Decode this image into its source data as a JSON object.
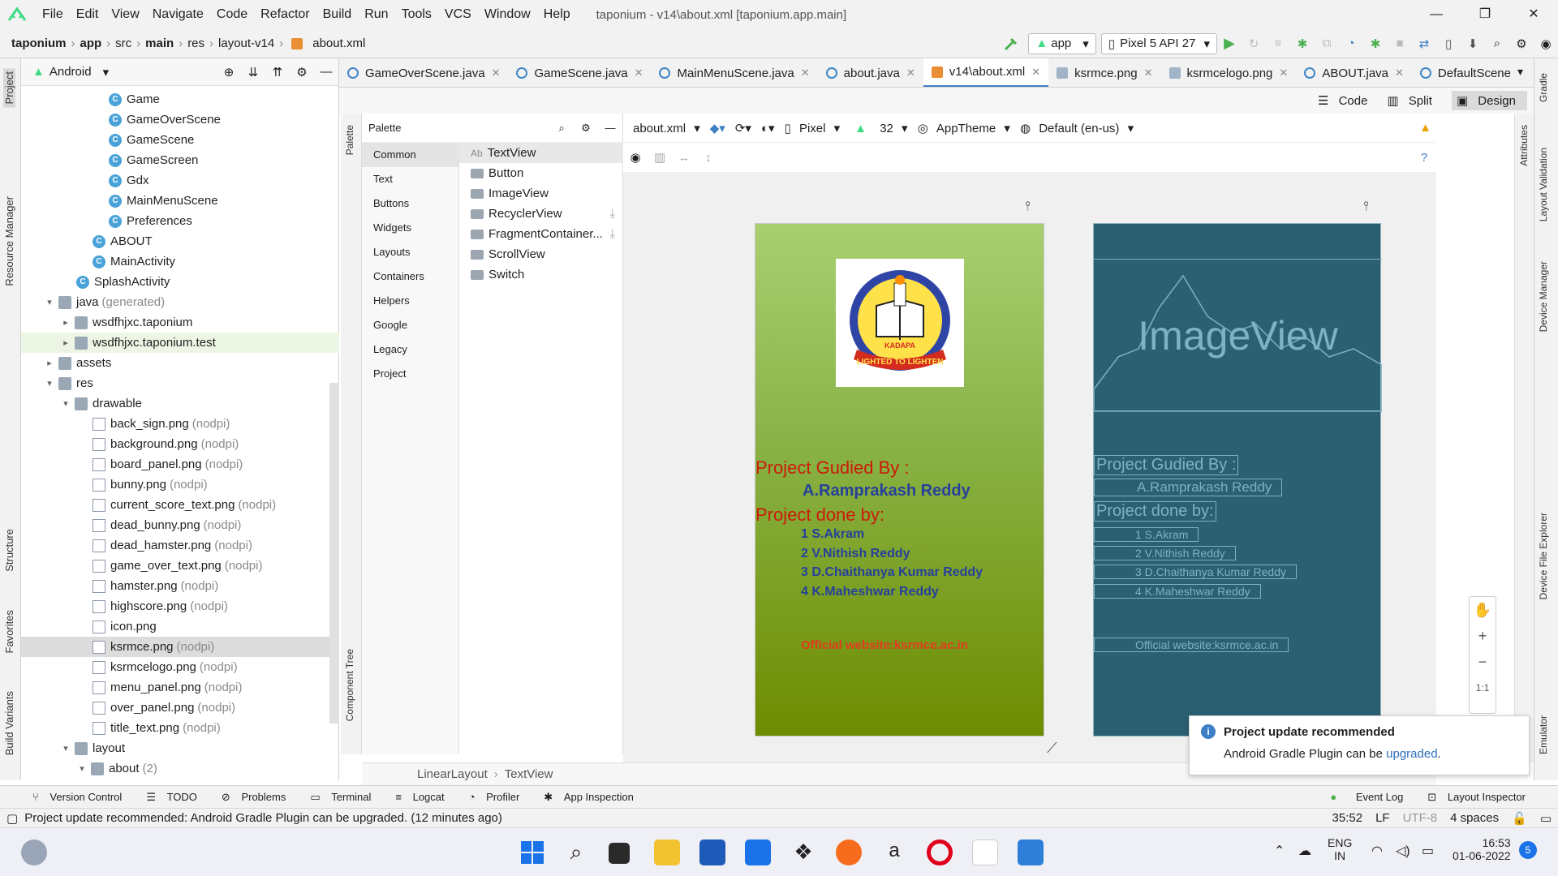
{
  "menubar": {
    "items": [
      "File",
      "Edit",
      "View",
      "Navigate",
      "Code",
      "Refactor",
      "Build",
      "Run",
      "Tools",
      "VCS",
      "Window",
      "Help"
    ],
    "title": "taponium - v14\\about.xml [taponium.app.main]"
  },
  "navbar": {
    "crumbs": [
      "taponium",
      "app",
      "src",
      "main",
      "res",
      "layout-v14",
      "about.xml"
    ],
    "run_config": "app",
    "device": "Pixel 5 API 27"
  },
  "project": {
    "view": "Android",
    "tree": [
      {
        "label": "Game",
        "type": "class",
        "indent": 5,
        "y": 0
      },
      {
        "label": "GameOverScene",
        "type": "class",
        "indent": 5,
        "y": 1
      },
      {
        "label": "GameScene",
        "type": "class",
        "indent": 5,
        "y": 2
      },
      {
        "label": "GameScreen",
        "type": "class",
        "indent": 5,
        "y": 3
      },
      {
        "label": "Gdx",
        "type": "class",
        "indent": 5,
        "y": 4
      },
      {
        "label": "MainMenuScene",
        "type": "class",
        "indent": 5,
        "y": 5
      },
      {
        "label": "Preferences",
        "type": "class",
        "indent": 5,
        "y": 6
      },
      {
        "label": "ABOUT",
        "type": "class",
        "indent": 4,
        "y": 7
      },
      {
        "label": "MainActivity",
        "type": "class",
        "indent": 4,
        "y": 8
      },
      {
        "label": "SplashActivity",
        "type": "class",
        "indent": 3,
        "y": 9
      },
      {
        "label": "java",
        "muted": "(generated)",
        "type": "folder",
        "indent": 1,
        "arrow": "▾",
        "y": 10
      },
      {
        "label": "wsdfhjxc.taponium",
        "type": "folder",
        "indent": 2,
        "arrow": "▸",
        "y": 11
      },
      {
        "label": "wsdfhjxc.taponium.test",
        "type": "folder",
        "indent": 2,
        "arrow": "▸",
        "y": 12,
        "hl": true
      },
      {
        "label": "assets",
        "type": "folder",
        "indent": 1,
        "arrow": "▸",
        "y": 13
      },
      {
        "label": "res",
        "type": "folder",
        "indent": 1,
        "arrow": "▾",
        "y": 14
      },
      {
        "label": "drawable",
        "type": "folder",
        "indent": 2,
        "arrow": "▾",
        "y": 15
      },
      {
        "label": "back_sign.png",
        "muted": "(nodpi)",
        "type": "file",
        "indent": 4,
        "y": 16
      },
      {
        "label": "background.png",
        "muted": "(nodpi)",
        "type": "file",
        "indent": 4,
        "y": 17
      },
      {
        "label": "board_panel.png",
        "muted": "(nodpi)",
        "type": "file",
        "indent": 4,
        "y": 18
      },
      {
        "label": "bunny.png",
        "muted": "(nodpi)",
        "type": "file",
        "indent": 4,
        "y": 19
      },
      {
        "label": "current_score_text.png",
        "muted": "(nodpi)",
        "type": "file",
        "indent": 4,
        "y": 20
      },
      {
        "label": "dead_bunny.png",
        "muted": "(nodpi)",
        "type": "file",
        "indent": 4,
        "y": 21
      },
      {
        "label": "dead_hamster.png",
        "muted": "(nodpi)",
        "type": "file",
        "indent": 4,
        "y": 22
      },
      {
        "label": "game_over_text.png",
        "muted": "(nodpi)",
        "type": "file",
        "indent": 4,
        "y": 23
      },
      {
        "label": "hamster.png",
        "muted": "(nodpi)",
        "type": "file",
        "indent": 4,
        "y": 24
      },
      {
        "label": "highscore.png",
        "muted": "(nodpi)",
        "type": "file",
        "indent": 4,
        "y": 25
      },
      {
        "label": "icon.png",
        "type": "file",
        "indent": 4,
        "y": 26
      },
      {
        "label": "ksrmce.png",
        "muted": "(nodpi)",
        "type": "file",
        "indent": 4,
        "y": 27,
        "sel": true
      },
      {
        "label": "ksrmcelogo.png",
        "muted": "(nodpi)",
        "type": "file",
        "indent": 4,
        "y": 28
      },
      {
        "label": "menu_panel.png",
        "muted": "(nodpi)",
        "type": "file",
        "indent": 4,
        "y": 29
      },
      {
        "label": "over_panel.png",
        "muted": "(nodpi)",
        "type": "file",
        "indent": 4,
        "y": 30
      },
      {
        "label": "title_text.png",
        "muted": "(nodpi)",
        "type": "file",
        "indent": 4,
        "y": 31
      },
      {
        "label": "layout",
        "type": "folder",
        "indent": 2,
        "arrow": "▾",
        "y": 32
      },
      {
        "label": "about",
        "muted": "(2)",
        "type": "folder",
        "indent": 3,
        "arrow": "▾",
        "y": 33
      }
    ]
  },
  "tabs": [
    {
      "label": "GameOverScene.java",
      "icon": "class"
    },
    {
      "label": "GameScene.java",
      "icon": "class"
    },
    {
      "label": "MainMenuScene.java",
      "icon": "class"
    },
    {
      "label": "about.java",
      "icon": "class"
    },
    {
      "label": "v14\\about.xml",
      "icon": "xml",
      "active": true
    },
    {
      "label": "ksrmce.png",
      "icon": "png"
    },
    {
      "label": "ksrmcelogo.png",
      "icon": "png"
    },
    {
      "label": "ABOUT.java",
      "icon": "class"
    },
    {
      "label": "DefaultScene",
      "icon": "class"
    }
  ],
  "viewmodes": {
    "code": "Code",
    "split": "Split",
    "design": "Design"
  },
  "palette": {
    "title": "Palette",
    "categories": [
      "Common",
      "Text",
      "Buttons",
      "Widgets",
      "Layouts",
      "Containers",
      "Helpers",
      "Google",
      "Legacy",
      "Project"
    ],
    "items": [
      "TextView",
      "Button",
      "ImageView",
      "RecyclerView",
      "FragmentContainer...",
      "ScrollView",
      "Switch"
    ],
    "textview_prefix": "Ab"
  },
  "design_toolbar": {
    "file": "about.xml",
    "device": "Pixel",
    "api": "32",
    "theme": "AppTheme",
    "locale": "Default (en-us)"
  },
  "preview": {
    "guided_label": "Project Gudied By :",
    "guide": "A.Ramprakash Reddy",
    "done_label": "Project done by:",
    "members": [
      "1 S.Akram",
      "2 V.Nithish Reddy",
      "3 D.Chaithanya Kumar Reddy",
      "4 K.Maheshwar Reddy"
    ],
    "website": "Official website:ksrmce.ac.in",
    "logo_text": "KADAPA",
    "logo_motto": "LIGHTED TO LIGHTEN",
    "blueprint_image": "ImageView"
  },
  "component_tree": "Component Tree",
  "bottom_crumbs": [
    "LinearLayout",
    "TextView"
  ],
  "notification": {
    "title": "Project update recommended",
    "body": "Android Gradle Plugin can be ",
    "link": "upgraded",
    "end": "."
  },
  "toolwindows": [
    "Version Control",
    "TODO",
    "Problems",
    "Terminal",
    "Logcat",
    "Profiler",
    "App Inspection"
  ],
  "toolwindows_right": [
    "Event Log",
    "Layout Inspector"
  ],
  "status": {
    "message": "Project update recommended: Android Gradle Plugin can be upgraded. (12 minutes ago)",
    "pos": "35:52",
    "le": "LF",
    "enc": "UTF-8",
    "indent": "4 spaces"
  },
  "left_strip": [
    "Project",
    "Resource Manager",
    "Structure",
    "Favorites",
    "Build Variants"
  ],
  "right_strip": [
    "Gradle",
    "Layout Validation",
    "Device Manager",
    "Device File Explorer",
    "Emulator"
  ],
  "attr_strip": "Attributes",
  "taskbar": {
    "lang": "ENG",
    "region": "IN",
    "time": "16:53",
    "date": "01-06-2022",
    "badge": "5"
  },
  "colors": {
    "accent": "#4083c9",
    "phone_green": "#8bb54a",
    "blueprint": "#2b5f72",
    "guide_red": "#cc1a0a",
    "member_blue": "#26419a"
  }
}
